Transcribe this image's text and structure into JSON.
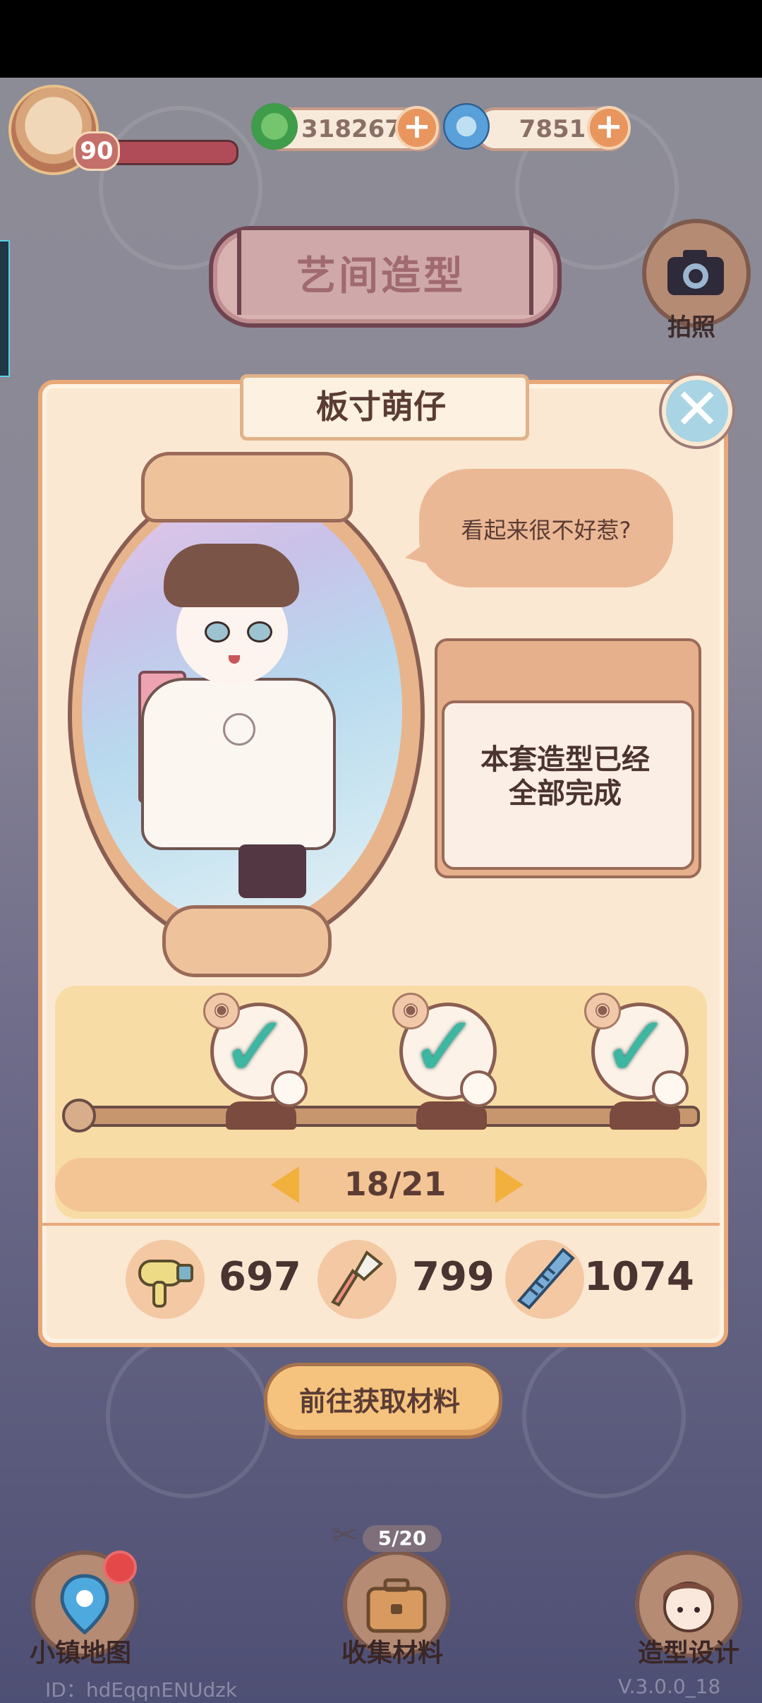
{
  "hud": {
    "level": "90",
    "leaf_currency": "318267",
    "swirl_currency": "7851",
    "plus_symbol": "+"
  },
  "title_sign": "艺间造型",
  "camera_label": "拍照",
  "panel": {
    "title": "板寸萌仔",
    "close_symbol": "✕",
    "speech": "看起来很不好惹?",
    "status_line1": "本套造型已经",
    "status_line2": "全部完成",
    "stage_check": "✓",
    "eye_symbol": "◉",
    "progress": "18/21",
    "materials": [
      {
        "icon": "hair-dryer-icon",
        "count": "697"
      },
      {
        "icon": "makeup-brush-icon",
        "count": "799"
      },
      {
        "icon": "comb-icon",
        "count": "1074"
      }
    ]
  },
  "goto_button": "前往获取材料",
  "bottom_nav": {
    "map_label": "小镇地图",
    "collect_label": "收集材料",
    "collect_counter": "5/20",
    "design_label": "造型设计"
  },
  "footer": {
    "id": "ID：hdEqqnENUdzk",
    "version": "V.3.0.0_18"
  },
  "colors": {
    "panel_bg": "#fbe8d2",
    "accent_orange": "#e8955e",
    "check_green": "#3db6a2",
    "arrow_yellow": "#f2b03d"
  }
}
